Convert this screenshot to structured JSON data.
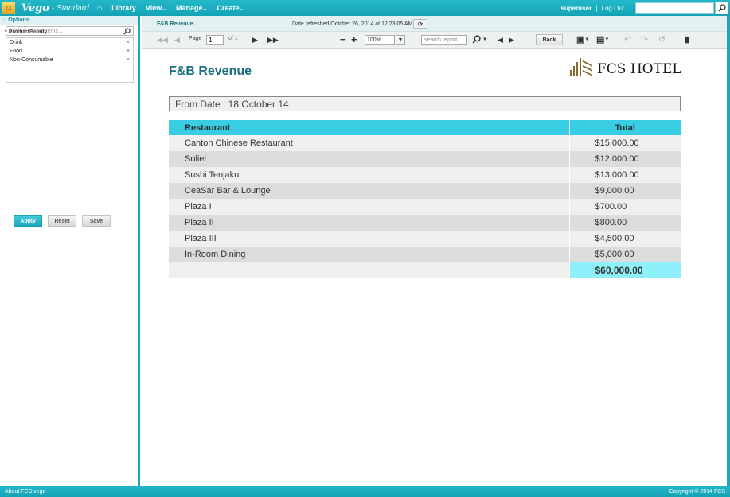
{
  "topbar": {
    "brand": "Vego",
    "edition": "- Standard",
    "nav": [
      {
        "label": "Library",
        "caret": ""
      },
      {
        "label": "View",
        "caret": "⌄"
      },
      {
        "label": "Manage",
        "caret": "⌄"
      },
      {
        "label": "Create",
        "caret": "⌄"
      }
    ],
    "user": "superuser",
    "separator": "|",
    "logout": "Log Out",
    "search_value": ""
  },
  "options": {
    "header": "Options",
    "field_label": "* ProductFamily",
    "select_placeholder": "Click to select items...",
    "items": [
      {
        "label": "Drink",
        "remove": "×"
      },
      {
        "label": "Food",
        "remove": "×"
      },
      {
        "label": "Non-Consumable",
        "remove": "×"
      }
    ],
    "apply_label": "Apply",
    "reset_label": "Reset",
    "save_label": "Save"
  },
  "report": {
    "tab": "F&B Revenue",
    "refreshed": "Date refreshed October 26, 2014 at 12:23:05 AM",
    "toolbar": {
      "page_label": "Page",
      "page_value": "1",
      "of_label": "of 1",
      "zoom": "100%",
      "search_placeholder": "search report",
      "back_label": "Back"
    },
    "title": "F&B Revenue",
    "logo_text": "FCS HOTEL",
    "from_date": "From Date : 18 October 14",
    "columns": [
      "Restaurant",
      "Total"
    ],
    "rows": [
      {
        "restaurant": "Canton Chinese Restaurant",
        "total": "$15,000.00"
      },
      {
        "restaurant": "Soliel",
        "total": "$12,000.00"
      },
      {
        "restaurant": "Sushi Tenjaku",
        "total": "$13,000.00"
      },
      {
        "restaurant": "CeaSar Bar & Lounge",
        "total": "$9,000.00"
      },
      {
        "restaurant": "Plaza I",
        "total": "$700.00"
      },
      {
        "restaurant": "Plaza II",
        "total": "$800.00"
      },
      {
        "restaurant": "Plaza III",
        "total": "$4,500.00"
      },
      {
        "restaurant": "In-Room Dining",
        "total": "$5,000.00"
      }
    ],
    "grand_total": "$60,000.00"
  },
  "footer": {
    "left": "About FCS vega",
    "right": "Copyright © 2014 FCS"
  },
  "colors": {
    "accent": "#1ba9ba",
    "header_cell": "#38cde2",
    "total_cell": "#8ef0fb",
    "title": "#1b6f80"
  }
}
